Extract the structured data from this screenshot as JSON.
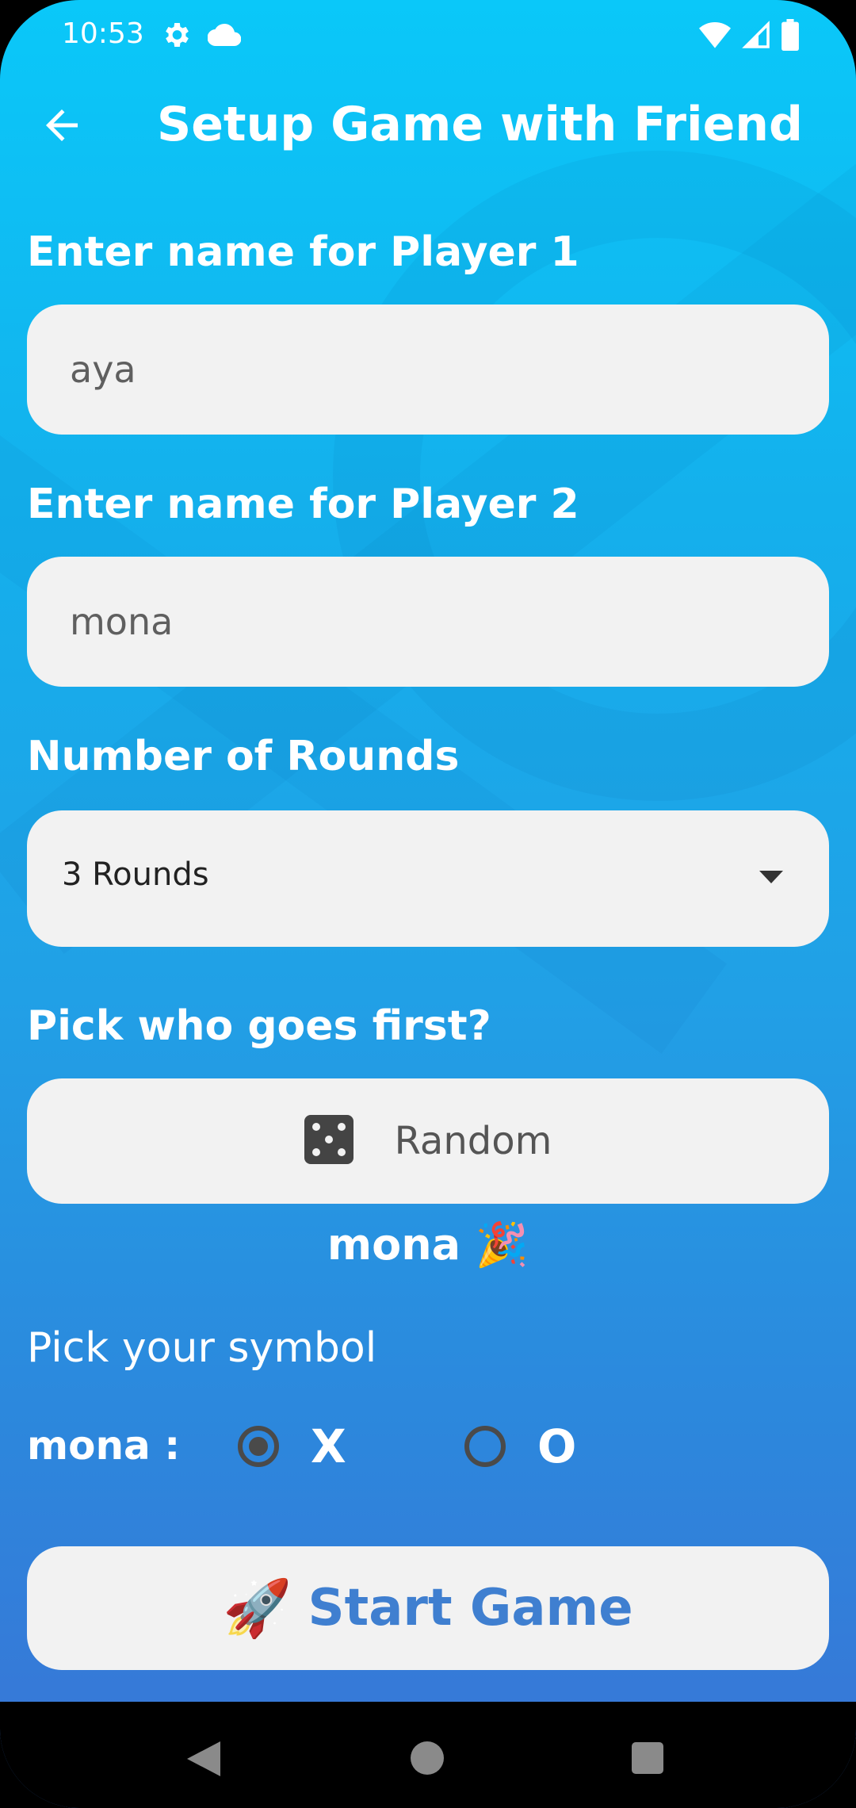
{
  "status_bar": {
    "time": "10:53",
    "icons": [
      "gear-icon",
      "cloud-icon",
      "wifi-icon",
      "signal-icon",
      "battery-icon"
    ]
  },
  "app_bar": {
    "back_icon": "arrow-left-icon",
    "title": "Setup Game with Friend"
  },
  "form": {
    "player1_label": "Enter name for Player 1",
    "player1_value": "aya",
    "player2_label": "Enter name for Player 2",
    "player2_value": "mona",
    "rounds_label": "Number of Rounds",
    "rounds_value": "3 Rounds",
    "first_label": "Pick who goes first?",
    "random_label": "Random",
    "random_icon": "dice-icon",
    "first_result": "mona 🎉",
    "symbol_label": "Pick your symbol",
    "symbol_player": "mona :",
    "symbol_x": "X",
    "symbol_o": "O",
    "selected_symbol": "X"
  },
  "start_button": {
    "icon": "🚀",
    "label": "Start Game"
  },
  "colors": {
    "background_top": "#0ac8f9",
    "background_bottom": "#3a74d6",
    "field_bg": "#f2f2f2",
    "start_text": "#3f7fd0"
  }
}
